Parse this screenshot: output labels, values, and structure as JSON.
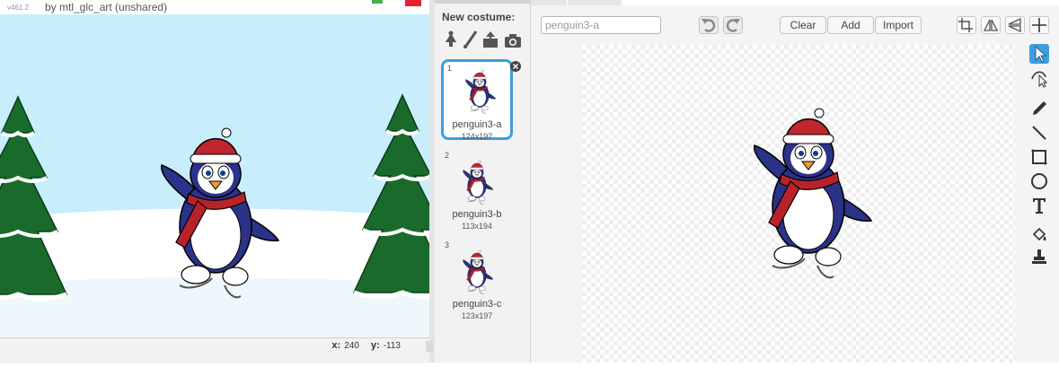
{
  "header": {
    "version": "v461.2",
    "project_by": "by mtl_glc_art (unshared)"
  },
  "stage": {
    "coords": {
      "x_label": "x:",
      "x_value": "240",
      "y_label": "y:",
      "y_value": "-113"
    }
  },
  "costume_panel": {
    "new_costume_label": "New costume:",
    "new_costume_icons": [
      "paint-from-library-icon",
      "paint-brush-icon",
      "upload-icon",
      "camera-icon"
    ],
    "costumes": [
      {
        "number": "1",
        "name": "penguin3-a",
        "size": "124x197",
        "selected": true
      },
      {
        "number": "2",
        "name": "penguin3-b",
        "size": "113x194",
        "selected": false
      },
      {
        "number": "3",
        "name": "penguin3-c",
        "size": "123x197",
        "selected": false
      }
    ]
  },
  "editor": {
    "costume_name_value": "penguin3-a",
    "buttons": {
      "clear": "Clear",
      "add": "Add",
      "import": "Import"
    },
    "top_icons": [
      "undo-icon",
      "redo-icon",
      "crop-icon",
      "flip-horizontal-icon",
      "flip-vertical-icon",
      "set-center-icon"
    ],
    "tools": [
      "select-icon",
      "reshape-icon",
      "pencil-icon",
      "line-icon",
      "rectangle-icon",
      "ellipse-icon",
      "text-icon",
      "fill-icon",
      "stamp-icon"
    ],
    "active_tool": "select-icon"
  },
  "colors": {
    "accent": "#3d9ede",
    "sky": "#c8eefb",
    "tree_green": "#1a6b2b",
    "penguin_body": "#2b3388",
    "scarf_red": "#b8232a"
  }
}
